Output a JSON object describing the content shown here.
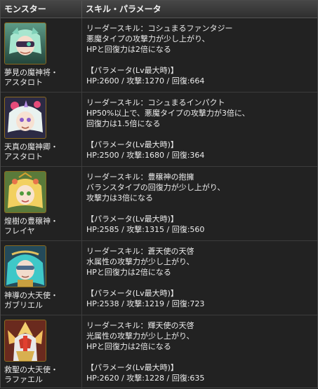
{
  "header": {
    "col_monster": "モンスター",
    "col_skill": "スキル・パラメータ"
  },
  "rows": [
    {
      "name": "夢見の魔神将・\nアスタロト",
      "icon": "monster-astaroth-dream-icon",
      "skill_line1": "リーダースキル：コシュまるファンタジー",
      "skill_line2": "悪魔タイプの攻撃力が少し上がり、",
      "skill_line3": "HPと回復力は2倍になる",
      "param_title": "【パラメータ(Lv最大時)】",
      "params": "HP:2600 / 攻撃:1270 / 回復:664"
    },
    {
      "name": "天真の魔神卿・\nアスタロト",
      "icon": "monster-astaroth-tenshin-icon",
      "skill_line1": "リーダースキル：コシュまるインパクト",
      "skill_line2": "HP50%以上で、悪魔タイプの攻撃力が3倍に、",
      "skill_line3": "回復力は1.5倍になる",
      "param_title": "【パラメータ(Lv最大時)】",
      "params": "HP:2500 / 攻撃:1680 / 回復:364"
    },
    {
      "name": "煌樹の豊穣神・\nフレイヤ",
      "icon": "monster-freyja-icon",
      "skill_line1": "リーダースキル：豊穣神の抱擁",
      "skill_line2": "バランスタイプの回復力が少し上がり、",
      "skill_line3": "攻撃力は3倍になる",
      "param_title": "【パラメータ(Lv最大時)】",
      "params": "HP:2585 / 攻撃:1315 / 回復:560"
    },
    {
      "name": "神導の大天使・\nガブリエル",
      "icon": "monster-gabriel-icon",
      "skill_line1": "リーダースキル：蒼天使の天啓",
      "skill_line2": "水属性の攻撃力が少し上がり、",
      "skill_line3": "HPと回復力は2倍になる",
      "param_title": "【パラメータ(Lv最大時)】",
      "params": "HP:2538 / 攻撃:1219 / 回復:723"
    },
    {
      "name": "救聖の大天使・\nラファエル",
      "icon": "monster-raphael-icon",
      "skill_line1": "リーダースキル：輝天使の天啓",
      "skill_line2": "光属性の攻撃力が少し上がり、",
      "skill_line3": "HPと回復力は2倍になる",
      "param_title": "【パラメータ(Lv最大時)】",
      "params": "HP:2620 / 攻撃:1228 / 回復:635"
    }
  ]
}
